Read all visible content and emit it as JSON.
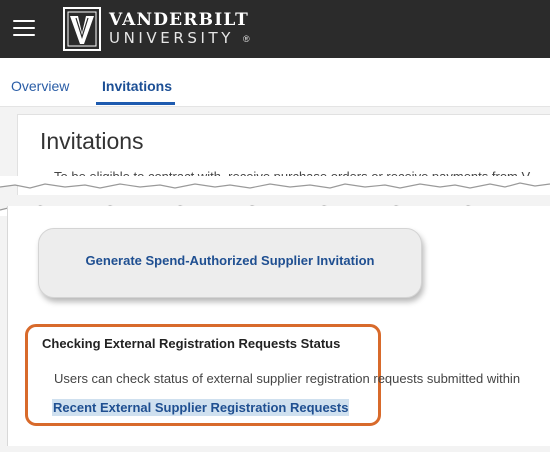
{
  "header": {
    "menu_icon": "hamburger-menu-icon",
    "logo_icon": "vanderbilt-v-shield-icon",
    "logo_name": "VANDERBILT",
    "logo_sub": "UNIVERSITY",
    "logo_reg": "®"
  },
  "tabs": [
    {
      "label": "Overview",
      "active": false
    },
    {
      "label": "Invitations",
      "active": true
    }
  ],
  "page": {
    "title": "Invitations",
    "intro": "To be eligible to contract with, receive purchase orders or receive payments from V"
  },
  "actions": {
    "generate_label": "Generate Spend-Authorized Supplier Invitation"
  },
  "status_section": {
    "title": "Checking External Registration Requests Status",
    "text": "Users can check status of external supplier registration requests submitted within",
    "link": "Recent External Supplier Registration Requests"
  },
  "colors": {
    "header_bg": "#2b2b2b",
    "link": "#1f4f91",
    "highlight_border": "#d86a2b",
    "link_highlight_bg": "#cfe0ef"
  }
}
